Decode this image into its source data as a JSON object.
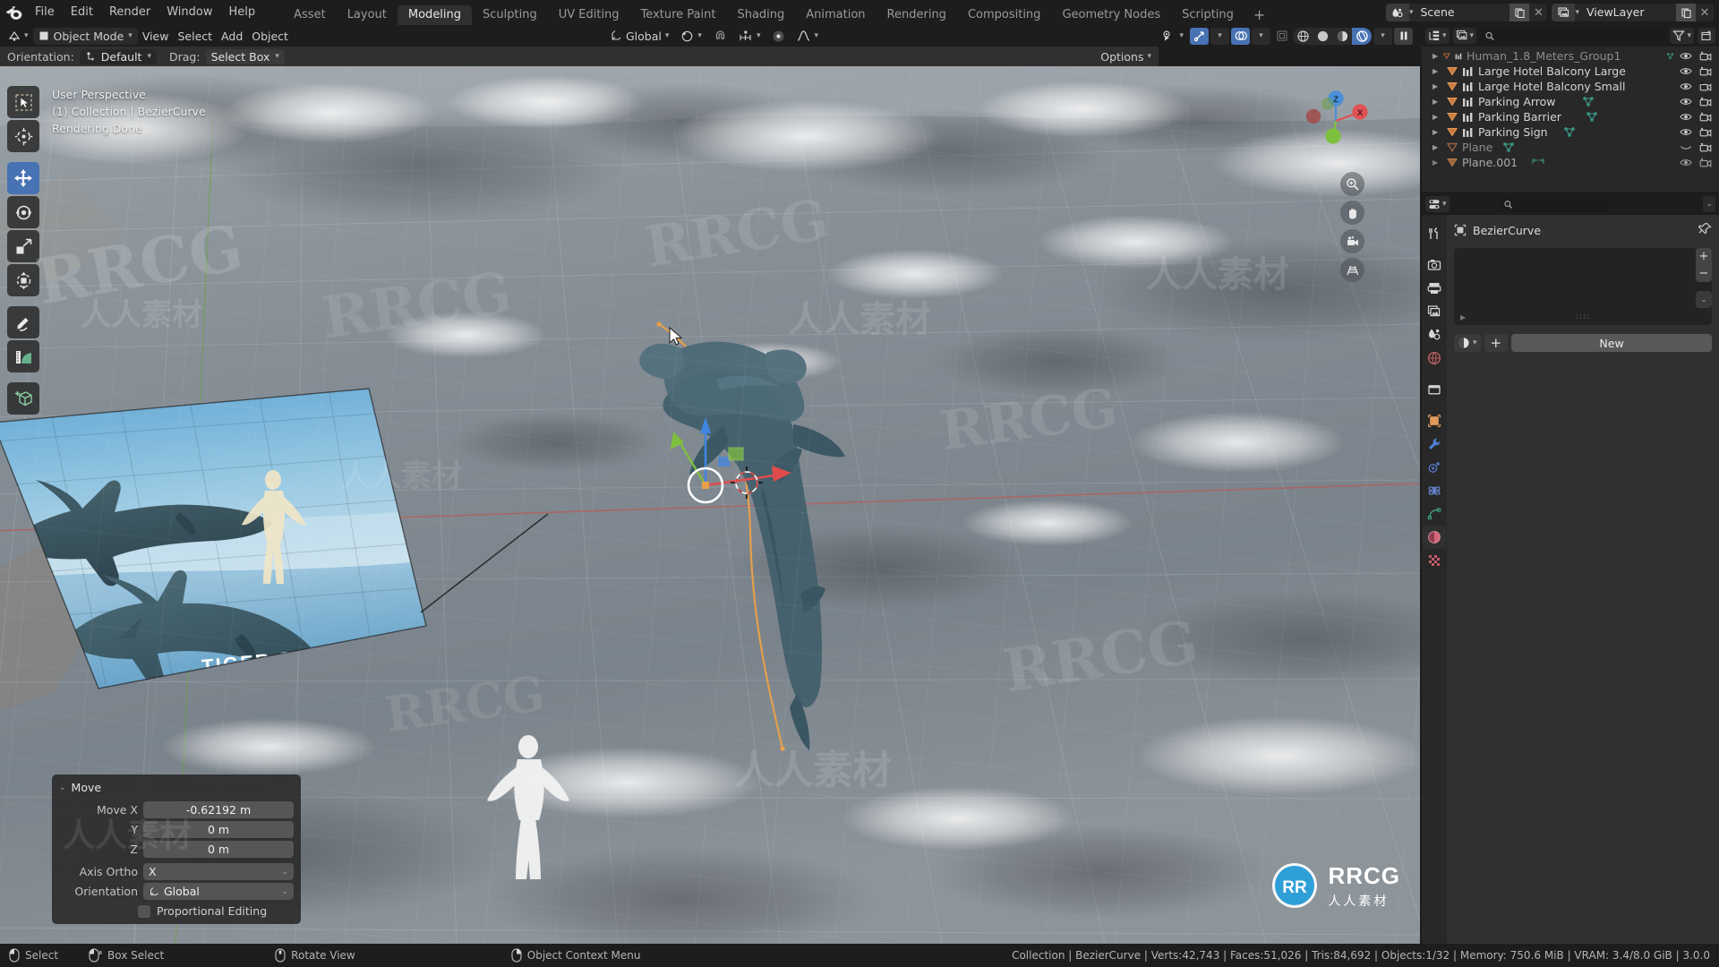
{
  "app": {
    "name": "Blender",
    "version": "3.0.0"
  },
  "topbar": {
    "logo_icon": "blender-logo-icon",
    "menus": [
      "File",
      "Edit",
      "Render",
      "Window",
      "Help"
    ],
    "workspaces": [
      {
        "label": "Asset",
        "active": false
      },
      {
        "label": "Layout",
        "active": false
      },
      {
        "label": "Modeling",
        "active": true
      },
      {
        "label": "Sculpting",
        "active": false
      },
      {
        "label": "UV Editing",
        "active": false
      },
      {
        "label": "Texture Paint",
        "active": false
      },
      {
        "label": "Shading",
        "active": false
      },
      {
        "label": "Animation",
        "active": false
      },
      {
        "label": "Rendering",
        "active": false
      },
      {
        "label": "Compositing",
        "active": false
      },
      {
        "label": "Geometry Nodes",
        "active": false
      },
      {
        "label": "Scripting",
        "active": false
      }
    ],
    "add_workspace_label": "+",
    "scene": {
      "icon": "scene-icon",
      "name": "Scene",
      "new_icon": "new-copy-icon",
      "unlink_icon": "x-icon"
    },
    "view_layer": {
      "icon": "viewlayer-icon",
      "name": "ViewLayer",
      "new_icon": "new-copy-icon",
      "unlink_icon": "x-icon"
    }
  },
  "viewport_header": {
    "editor_type_icon": "editor-type-icon",
    "mode": "Object Mode",
    "mode_icon": "object-mode-icon",
    "menus": [
      "View",
      "Select",
      "Add",
      "Object"
    ],
    "transform_orientation": "Global",
    "transform_orientation_icon": "orientation-global-icon",
    "pivot_icon": "pivot-point-icon",
    "snap_icon": "snap-magnet-icon",
    "snap_target_icon": "snap-increment-icon",
    "proportional_icon": "proportional-editing-icon",
    "falloff_icon": "falloff-smooth-icon",
    "visibility_icon": "object-types-visibility-icon",
    "gizmo_icon": "gizmo-icon",
    "overlays_icon": "overlays-icon",
    "xray_icon": "xray-icon",
    "shading_modes": [
      {
        "icon": "shading-wireframe-icon",
        "label": "Wireframe",
        "active": false
      },
      {
        "icon": "shading-solid-icon",
        "label": "Solid",
        "active": false
      },
      {
        "icon": "shading-material-icon",
        "label": "Material Preview",
        "active": false
      },
      {
        "icon": "shading-rendered-icon",
        "label": "Rendered",
        "active": true
      }
    ],
    "shading_dropdown_icon": "chevron-down-icon",
    "pause_icon": "pause-icon"
  },
  "tool_settings": {
    "orientation_label": "Orientation:",
    "orientation_value": "Default",
    "orientation_icon": "orientation-icon",
    "drag_label": "Drag:",
    "drag_value": "Select Box",
    "options_label": "Options"
  },
  "viewport": {
    "info_lines": [
      "User Perspective",
      "(1) Collection | BezierCurve",
      "Rendering Done"
    ],
    "toolbar": [
      {
        "icon": "select-box-icon",
        "name": "tweak-select-box-tool",
        "active": false
      },
      {
        "icon": "cursor-3d-icon",
        "name": "cursor-tool",
        "active": false
      },
      {
        "icon": "move-tool-icon",
        "name": "move-tool",
        "active": true
      },
      {
        "icon": "rotate-tool-icon",
        "name": "rotate-tool",
        "active": false
      },
      {
        "icon": "scale-tool-icon",
        "name": "scale-tool",
        "active": false
      },
      {
        "icon": "transform-tool-icon",
        "name": "transform-tool",
        "active": false
      },
      {
        "icon": "annotate-icon",
        "name": "annotate-tool",
        "active": false
      },
      {
        "icon": "measure-icon",
        "name": "measure-tool",
        "active": false
      },
      {
        "icon": "add-cube-icon",
        "name": "add-cube-tool",
        "active": false
      }
    ],
    "nav_gizmo": {
      "axes": [
        "Z",
        "X",
        "Y"
      ],
      "color_x": "#e05252",
      "color_y": "#7fbf3f",
      "color_z": "#4a8fd8"
    },
    "nav_buttons": [
      {
        "icon": "zoom-icon",
        "name": "zoom-view-button"
      },
      {
        "icon": "hand-icon",
        "name": "move-view-button"
      },
      {
        "icon": "camera-icon",
        "name": "camera-view-button"
      },
      {
        "icon": "grid-perspective-icon",
        "name": "toggle-perspective-button"
      }
    ],
    "reference_plane": {
      "caption": "TIGER SHARK"
    },
    "gizmo": {
      "axis_x_color": "#e04c4c",
      "axis_y_color": "#7fbf3f",
      "axis_z_color": "#3f86e0"
    },
    "curve_color": "#e8a049"
  },
  "operator_panel": {
    "title": "Move",
    "collapse_icon": "chevron-down-icon",
    "rows": [
      {
        "label": "Move X",
        "value": "-0.62192 m"
      },
      {
        "label": "Y",
        "value": "0 m"
      },
      {
        "label": "Z",
        "value": "0 m"
      }
    ],
    "axis_ortho": {
      "label": "Axis Ortho",
      "value": "X"
    },
    "orientation": {
      "label": "Orientation",
      "value": "Global",
      "icon": "orientation-global-icon"
    },
    "proportional": {
      "label": "Proportional Editing",
      "checked": false
    }
  },
  "outliner": {
    "display_mode_icon": "outliner-display-mode-icon",
    "filter_id_icon": "viewlayer-icon",
    "search_placeholder": "",
    "search_value": "",
    "search_icon": "search-icon",
    "filter_icon": "filter-funnel-icon",
    "new_collection_icon": "new-collection-icon",
    "rows": [
      {
        "name": "Human_1.8_Meters_Group1",
        "type_icon": "mesh-data-icon",
        "has_child_icon": true,
        "dim": true,
        "hidden": false
      },
      {
        "name": "Large Hotel Balcony Large",
        "type_icon": "mesh-data-icon",
        "has_child_icon": false,
        "dim": false,
        "hidden": false
      },
      {
        "name": "Large Hotel Balcony Small",
        "type_icon": "mesh-data-icon",
        "has_child_icon": false,
        "dim": false,
        "hidden": false
      },
      {
        "name": "Parking Arrow",
        "type_icon": "mesh-data-icon",
        "has_child_icon": true,
        "dim": false,
        "hidden": false
      },
      {
        "name": "Parking Barrier",
        "type_icon": "mesh-data-icon",
        "has_child_icon": true,
        "dim": false,
        "hidden": false
      },
      {
        "name": "Parking Sign",
        "type_icon": "mesh-data-icon",
        "has_child_icon": true,
        "dim": false,
        "hidden": false
      },
      {
        "name": "Plane",
        "type_icon": "mesh-data-icon",
        "has_child_icon": true,
        "dim": true,
        "hidden": true
      },
      {
        "name": "Plane.001",
        "type_icon": "mesh-data-icon",
        "has_child_icon": true,
        "dim": false,
        "hidden": false
      }
    ],
    "eye_icon": "eye-icon",
    "eye_closed_icon": "eye-closed-icon",
    "camera_icon": "camera-restrict-icon"
  },
  "properties": {
    "editor_icon": "properties-editor-icon",
    "search_placeholder": "",
    "search_icon": "search-icon",
    "expand_icon": "chevron-down-icon",
    "tabs": [
      {
        "icon": "tool-icon",
        "name": "tool-properties-tab",
        "active": false
      },
      {
        "icon": "render-icon",
        "name": "render-properties-tab",
        "active": false
      },
      {
        "icon": "output-icon",
        "name": "output-properties-tab",
        "active": false
      },
      {
        "icon": "viewlayer-props-icon",
        "name": "viewlayer-properties-tab",
        "active": false
      },
      {
        "icon": "scene-props-icon",
        "name": "scene-properties-tab",
        "active": false
      },
      {
        "icon": "world-icon",
        "name": "world-properties-tab",
        "active": false
      },
      {
        "icon": "collection-icon",
        "name": "collection-properties-tab",
        "active": false
      },
      {
        "icon": "object-icon",
        "name": "object-properties-tab",
        "active": false
      },
      {
        "icon": "modifier-wrench-icon",
        "name": "modifier-properties-tab",
        "active": false
      },
      {
        "icon": "particles-icon",
        "name": "particle-properties-tab",
        "active": false
      },
      {
        "icon": "physics-icon",
        "name": "physics-properties-tab",
        "active": false
      },
      {
        "icon": "curve-data-icon",
        "name": "object-data-properties-tab",
        "active": false
      },
      {
        "icon": "material-icon",
        "name": "material-properties-tab",
        "active": true
      },
      {
        "icon": "texture-checker-icon",
        "name": "texture-properties-tab",
        "active": false
      }
    ],
    "breadcrumb": {
      "icon": "object-icon",
      "name": "BezierCurve"
    },
    "pin_icon": "pin-icon",
    "slot_add_icon": "+",
    "slot_remove_icon": "−",
    "slot_menu_icon": "chevron-down-icon",
    "material_icon": "material-sphere-icon",
    "browse_icon": "chevron-down-icon",
    "add_icon": "+",
    "new_button_label": "New"
  },
  "statusbar": {
    "hints": [
      {
        "icon": "mouse-left-icon",
        "label": "Select"
      },
      {
        "icon": "mouse-left-drag-icon",
        "label": "Box Select"
      },
      {
        "icon": "mouse-middle-icon",
        "label": "Rotate View"
      },
      {
        "icon": "mouse-right-icon",
        "label": "Object Context Menu"
      }
    ],
    "stats": "Collection | BezierCurve | Verts:42,743 | Faces:51,026 | Tris:84,692 | Objects:1/32 | Memory: 750.6 MiB | VRAM: 3.4/8.0 GiB | 3.0.0"
  },
  "watermarks": {
    "brand": "RRCG",
    "brand_cn": "人人素材",
    "badge_letters": "RR"
  }
}
